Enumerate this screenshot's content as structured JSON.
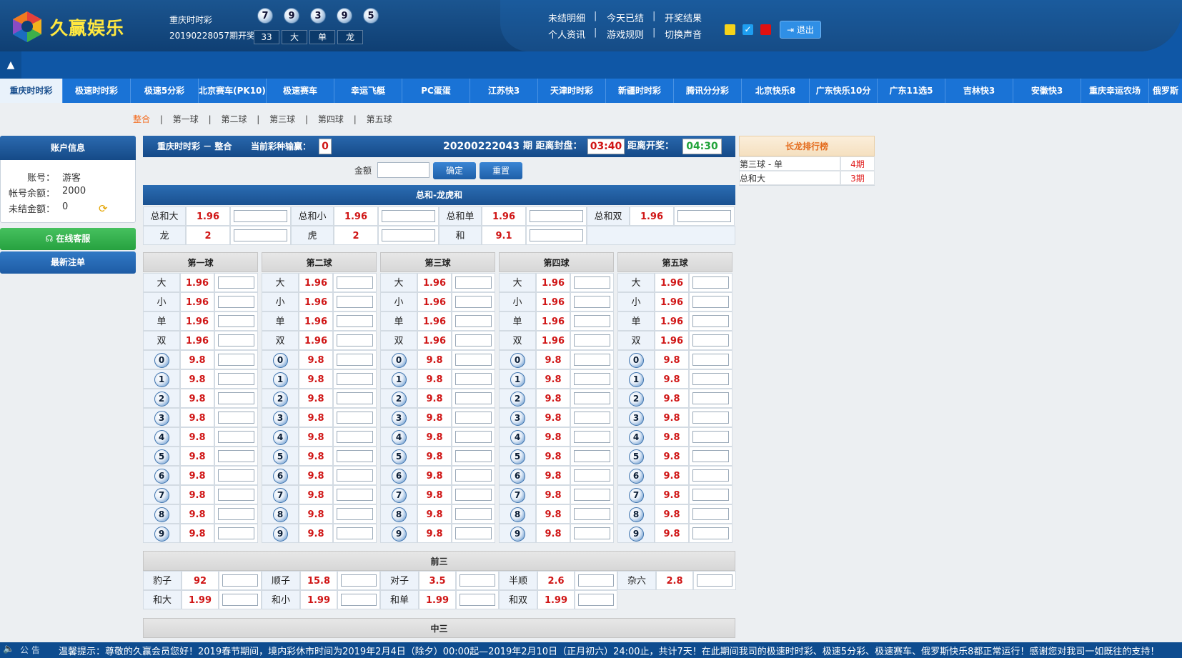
{
  "header": {
    "brand": "久赢娱乐",
    "lottery_name": "重庆时时彩",
    "issue_label": "20190228057期开奖",
    "balls": [
      "7",
      "9",
      "3",
      "9",
      "5"
    ],
    "sum_boxes": [
      "33",
      "大",
      "单",
      "龙"
    ],
    "links_row1": [
      "未结明细",
      "今天已结",
      "开奖结果"
    ],
    "links_row2": [
      "个人资讯",
      "游戏规则",
      "切换声音"
    ],
    "separator": "|",
    "logout": "退出",
    "color_swatches": [
      "#f5d31a",
      "#1e9ef0",
      "#e01010"
    ],
    "collapse_icon": "▲"
  },
  "tabs": [
    "重庆时时彩",
    "极速时时彩",
    "极速5分彩",
    "北京赛车(PK10)",
    "极速赛车",
    "幸运飞艇",
    "PC蛋蛋",
    "江苏快3",
    "天津时时彩",
    "新疆时时彩",
    "腾讯分分彩",
    "北京快乐8",
    "广东快乐10分",
    "广东11选5",
    "吉林快3",
    "安徽快3",
    "重庆幸运农场",
    "俄罗斯"
  ],
  "subnav": [
    "整合",
    "|",
    "第一球",
    "|",
    "第二球",
    "|",
    "第三球",
    "|",
    "第四球",
    "|",
    "第五球"
  ],
  "account": {
    "title": "账户信息",
    "account_label": "账号：",
    "account_value": "游客",
    "balance_label": "帐号余额：",
    "balance_value": "2000",
    "unsettled_label": "未结金额：",
    "unsettled_value": "0",
    "online_service": "在线客服",
    "latest_bets": "最新注单"
  },
  "main": {
    "title": "重庆时时彩 － 整合",
    "profit_label": "当前彩种输赢：",
    "profit_value": "0",
    "period": "20200222043",
    "period_suffix": "期 距离封盘：",
    "close_time": "03:40",
    "open_label": "距离开奖：",
    "open_time": "04:30",
    "amount_label": "金额",
    "confirm": "确定",
    "reset": "重置"
  },
  "sum_section": {
    "title": "总和-龙虎和",
    "row1": [
      [
        "总和大",
        "1.96"
      ],
      [
        "总和小",
        "1.96"
      ],
      [
        "总和单",
        "1.96"
      ],
      [
        "总和双",
        "1.96"
      ]
    ],
    "row2": [
      [
        "龙",
        "2"
      ],
      [
        "虎",
        "2"
      ],
      [
        "和",
        "9.1"
      ]
    ]
  },
  "balls_section": {
    "columns": [
      "第一球",
      "第二球",
      "第三球",
      "第四球",
      "第五球"
    ],
    "bsoe": [
      [
        "大",
        "1.96"
      ],
      [
        "小",
        "1.96"
      ],
      [
        "单",
        "1.96"
      ],
      [
        "双",
        "1.96"
      ]
    ],
    "digits": [
      "0",
      "1",
      "2",
      "3",
      "4",
      "5",
      "6",
      "7",
      "8",
      "9"
    ],
    "digit_odds": "9.8"
  },
  "front3": {
    "title": "前三",
    "row1": [
      [
        "豹子",
        "92"
      ],
      [
        "顺子",
        "15.8"
      ],
      [
        "对子",
        "3.5"
      ],
      [
        "半顺",
        "2.6"
      ],
      [
        "杂六",
        "2.8"
      ]
    ],
    "row2": [
      [
        "和大",
        "1.99"
      ],
      [
        "和小",
        "1.99"
      ],
      [
        "和单",
        "1.99"
      ],
      [
        "和双",
        "1.99"
      ]
    ]
  },
  "mid3": {
    "title": "中三"
  },
  "dragon": {
    "title": "长龙排行榜",
    "rows": [
      [
        "第三球 - 单",
        "4期"
      ],
      [
        "总和大",
        "3期"
      ]
    ]
  },
  "notice": {
    "label": "公 告",
    "text": "温馨提示：尊敬的久赢会员您好！2019春节期间，境内彩休市时间为2019年2月4日（除夕）00:00起—2019年2月10日（正月初六）24:00止，共计7天！在此期间我司的极速时时彩、极速5分彩、极速赛车、俄罗斯快乐8都正常运行！感谢您对我司一如既往的支持！"
  }
}
